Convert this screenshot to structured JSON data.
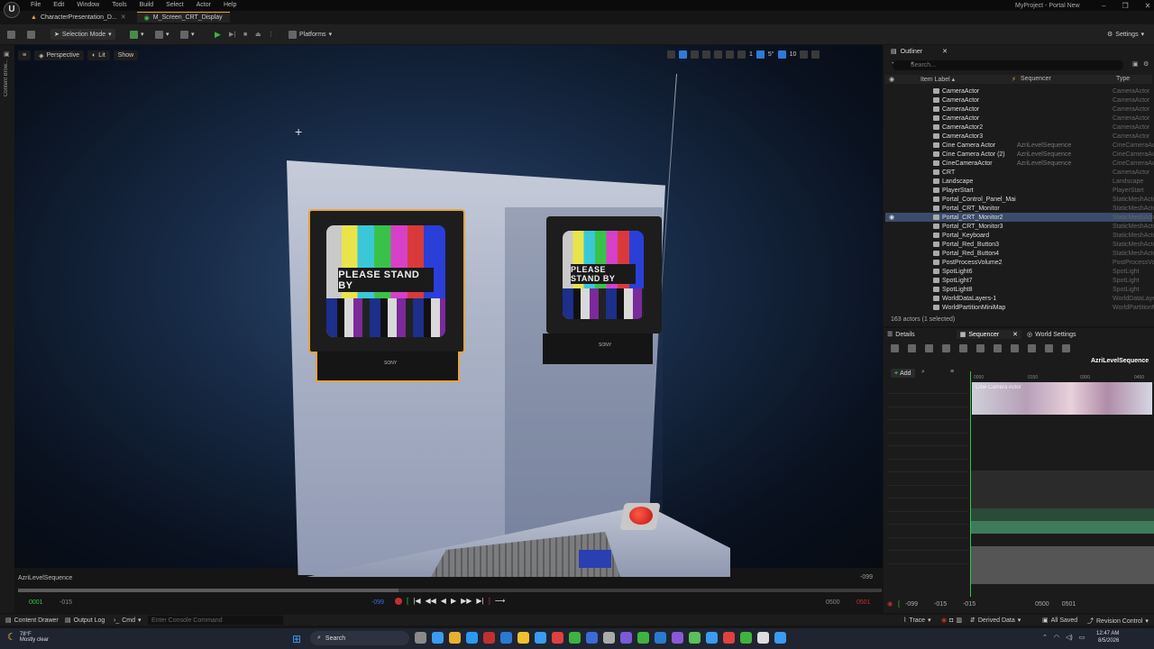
{
  "titlebar": {
    "logo": "U",
    "menus": [
      "File",
      "Edit",
      "Window",
      "Tools",
      "Build",
      "Select",
      "Actor",
      "Help"
    ],
    "window_title": "MyProject - Portal New",
    "controls": [
      "–",
      "❐",
      "✕"
    ]
  },
  "doc_tabs": [
    {
      "label": "CharacterPresentation_D...",
      "active": false
    },
    {
      "label": "M_Screen_CRT_Display",
      "active": true
    }
  ],
  "toolbar": {
    "selection_mode": "Selection Mode",
    "platforms": "Platforms",
    "settings": "Settings"
  },
  "left_strip": {
    "content_browser": "Content Brow..."
  },
  "viewport": {
    "perspective": "Perspective",
    "lit": "Lit",
    "show": "Show",
    "snap_angle": "5°",
    "snap_grid": "10",
    "camera_speed": "1",
    "monitor_left_text": "PLEASE STAND BY",
    "monitor_right_text": "PLEASE STAND BY",
    "brand": "SONY",
    "sequence_label": "AzriLevelSequence",
    "frame_readout": "-099"
  },
  "transport": {
    "start": "0001",
    "lower": "-015",
    "current": "-099",
    "upper": "0500",
    "end": "0501",
    "progress": 0.44
  },
  "outliner": {
    "tab": "Outliner",
    "search_placeholder": "Search...",
    "col_label": "Item Label ▴",
    "col_sequencer": "Sequencer",
    "col_type": "Type",
    "rows": [
      {
        "name": "CameraActor",
        "seq": "",
        "type": "CameraActor",
        "sel": false
      },
      {
        "name": "CameraActor",
        "seq": "",
        "type": "CameraActor",
        "sel": false
      },
      {
        "name": "CameraActor",
        "seq": "",
        "type": "CameraActor",
        "sel": false
      },
      {
        "name": "CameraActor",
        "seq": "",
        "type": "CameraActor",
        "sel": false
      },
      {
        "name": "CameraActor2",
        "seq": "",
        "type": "CameraActor",
        "sel": false
      },
      {
        "name": "CameraActor3",
        "seq": "",
        "type": "CameraActor",
        "sel": false
      },
      {
        "name": "Cine Camera Actor",
        "seq": "AzriLevelSequence",
        "type": "CineCameraActor",
        "sel": false
      },
      {
        "name": "Cine Camera Actor (2)",
        "seq": "AzriLevelSequence",
        "type": "CineCameraActor",
        "sel": false
      },
      {
        "name": "CineCameraActor",
        "seq": "AzriLevelSequence",
        "type": "CineCameraActor",
        "sel": false
      },
      {
        "name": "CRT",
        "seq": "",
        "type": "CameraActor",
        "sel": false
      },
      {
        "name": "Landscape",
        "seq": "",
        "type": "Landscape",
        "sel": false
      },
      {
        "name": "PlayerStart",
        "seq": "",
        "type": "PlayerStart",
        "sel": false
      },
      {
        "name": "Portal_Control_Panel_Mai",
        "seq": "",
        "type": "StaticMeshActor",
        "sel": false
      },
      {
        "name": "Portal_CRT_Monitor",
        "seq": "",
        "type": "StaticMeshActor",
        "sel": false
      },
      {
        "name": "Portal_CRT_Monitor2",
        "seq": "",
        "type": "StaticMeshActor",
        "sel": true
      },
      {
        "name": "Portal_CRT_Monitor3",
        "seq": "",
        "type": "StaticMeshActor",
        "sel": false
      },
      {
        "name": "Portal_Keyboard",
        "seq": "",
        "type": "StaticMeshActor",
        "sel": false
      },
      {
        "name": "Portal_Red_Button3",
        "seq": "",
        "type": "StaticMeshActor",
        "sel": false
      },
      {
        "name": "Portal_Red_Button4",
        "seq": "",
        "type": "StaticMeshActor",
        "sel": false
      },
      {
        "name": "PostProcessVolume2",
        "seq": "",
        "type": "PostProcessVolume",
        "sel": false
      },
      {
        "name": "SpotLight6",
        "seq": "",
        "type": "SpotLight",
        "sel": false
      },
      {
        "name": "SpotLight7",
        "seq": "",
        "type": "SpotLight",
        "sel": false
      },
      {
        "name": "SpotLight8",
        "seq": "",
        "type": "SpotLight",
        "sel": false
      },
      {
        "name": "WorldDataLayers-1",
        "seq": "",
        "type": "WorldDataLayers",
        "sel": false
      },
      {
        "name": "WorldPartitionMiniMap",
        "seq": "",
        "type": "WorldPartitionMiniMap",
        "sel": false
      }
    ],
    "count": "163 actors (1 selected)"
  },
  "sequencer": {
    "tabs": [
      "Details",
      "Sequencer",
      "World Settings"
    ],
    "sequence_name": "AzriLevelSequence",
    "add": "Add",
    "track_label": "Cine Camera Actor",
    "ticks": [
      "0000",
      "0150",
      "0300",
      "0450"
    ],
    "bottom": [
      "-099",
      "-015",
      "-015",
      "0500",
      "0501"
    ]
  },
  "statusbar": {
    "content_drawer": "Content Drawer",
    "output_log": "Output Log",
    "cmd": "Cmd",
    "console_placeholder": "Enter Console Command",
    "trace": "Trace",
    "derived_data": "Derived Data",
    "all_saved": "All Saved",
    "revision_control": "Revision Control"
  },
  "taskbar": {
    "temp": "78°F",
    "weather": "Mostly clear",
    "search": "Search",
    "time": "12:47 AM",
    "date": "8/5/2026"
  },
  "colors": {
    "accent": "#2d7bd6",
    "play_green": "#3fb33f",
    "record_red": "#c03030",
    "selection": "#3a4c6a",
    "tab_highlight": "#e8a33d"
  }
}
